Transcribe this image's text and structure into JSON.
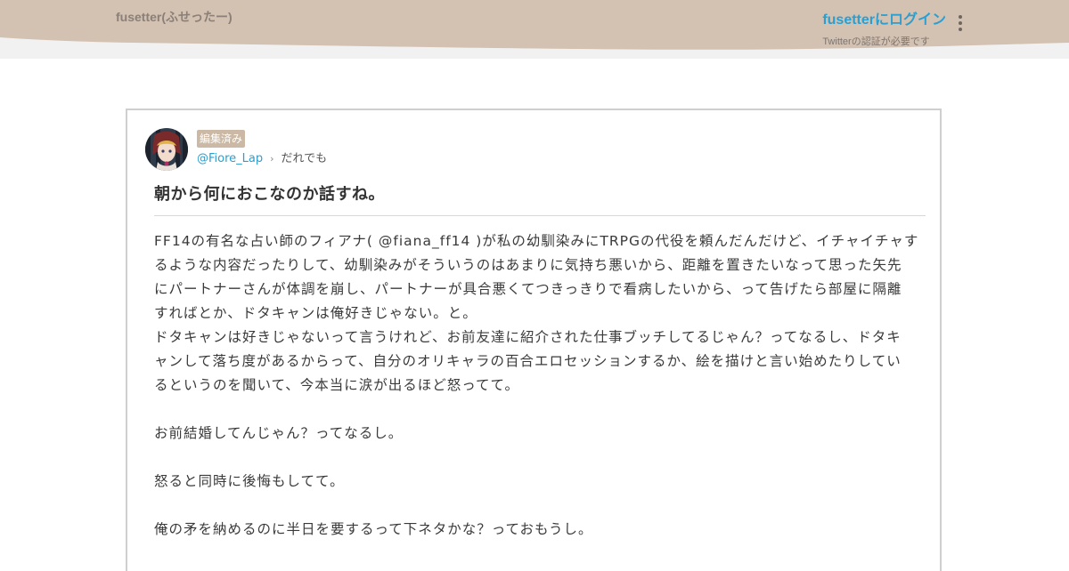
{
  "header": {
    "site_title": "fusetter(ふせったー)",
    "login_label": "fusetterにログイン",
    "login_note": "Twitterの認証が必要です"
  },
  "colors": {
    "header_band": "#d3c1b2",
    "header_shadow": "#f1f1f1",
    "accent_link": "#2a9fd0",
    "badge": "#cbb9a6"
  },
  "post": {
    "badge": "編集済み",
    "author": "@Fiore_Lap",
    "audience": "だれでも",
    "title": "朝から何におこなのか話すね。",
    "body": {
      "p1_line1": "FF14の有名な占い師のフィアナ( @fiana_ff14 )が私の幼馴染みにTRPGの代役を頼んだんだけど、イチャイチャす",
      "p1_line2": "るような内容だったりして、幼馴染みがそういうのはあまりに気持ち悪いから、距離を置きたいなって思った矢先",
      "p1_line3": "にパートナーさんが体調を崩し、パートナーが具合悪くてつきっきりで看病したいから、って告げたら部屋に隔離",
      "p1_line4": "すればとか、ドタキャンは俺好きじゃない。と。",
      "p2_line1": "ドタキャンは好きじゃないって言うけれど、お前友達に紹介された仕事ブッチしてるじゃん？ってなるし、ドタキ",
      "p2_line2": "ャンして落ち度があるからって、自分のオリキャラの百合エロセッションするか、絵を描けと言い始めたりしてい",
      "p2_line3": "るというのを聞いて、今本当に涙が出るほど怒ってて。",
      "p3": "お前結婚してんじゃん？ってなるし。",
      "p4": "怒ると同時に後悔もしてて。",
      "p5": "俺の矛を納めるのに半日を要するって下ネタかな？っておもうし。"
    }
  }
}
